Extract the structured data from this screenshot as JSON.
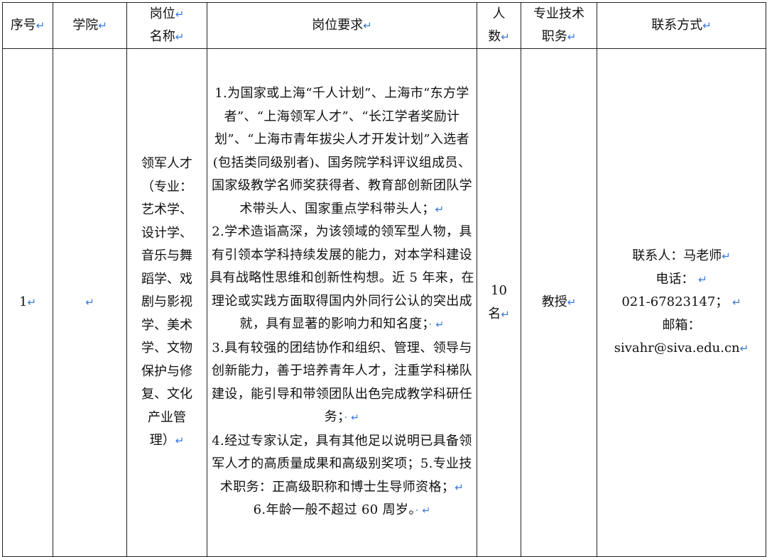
{
  "table": {
    "headers": {
      "index": "序号",
      "college": "学院",
      "post_name_line1": "岗位",
      "post_name_line2": "名称",
      "requirements": "岗位要求",
      "count_line1": "人",
      "count_line2": "数",
      "title_line1": "专业技术",
      "title_line2": "职务",
      "contact": "联系方式"
    },
    "row": {
      "index": "1",
      "college": "",
      "post_name": "领军人才（专业：艺术学、设计学、音乐与舞蹈学、戏剧与影视学、美术学、文物保护与修复、文化产业管理）",
      "requirements": [
        "1.为国家或上海“千人计划”、上海市“东方学者”、“上海领军人才”、“长江学者奖励计划”、“上海市青年拔尖人才开发计划”入选者(包括类同级别者)、国务院学科评议组成员、国家级教学名师奖获得者、教育部创新团队学术带头人、国家重点学科带头人；",
        "2.学术造诣高深，为该领域的领军型人物，具有引领本学科持续发展的能力，对本学科建设具有战略性思维和创新性构想。近 5 年来，在理论或实践方面取得国内外同行公认的突出成就，具有显著的影响力和知名度；",
        "3.具有较强的团结协作和组织、管理、领导与创新能力，善于培养青年人才，注重学科梯队建设，能引导和带领团队出色完成教学科研任务；",
        "4.经过专家认定，具有其他足以说明已具备领军人才的高质量成果和高级别奖项；5.专业技术职务：正高级职称和博士生导师资格；",
        "6.年龄一般不超过 60 周岁。"
      ],
      "count_number": "10",
      "count_unit": "名",
      "title": "教授",
      "contact": {
        "person": "联系人：马老师",
        "phone_label": "电话：",
        "phone": "021-67823147；",
        "email_label": "邮箱：",
        "email": "sivahr@siva.edu.cn"
      }
    },
    "marks": {
      "paragraph": "↵",
      "dot_paragraph": "· ↵"
    }
  }
}
